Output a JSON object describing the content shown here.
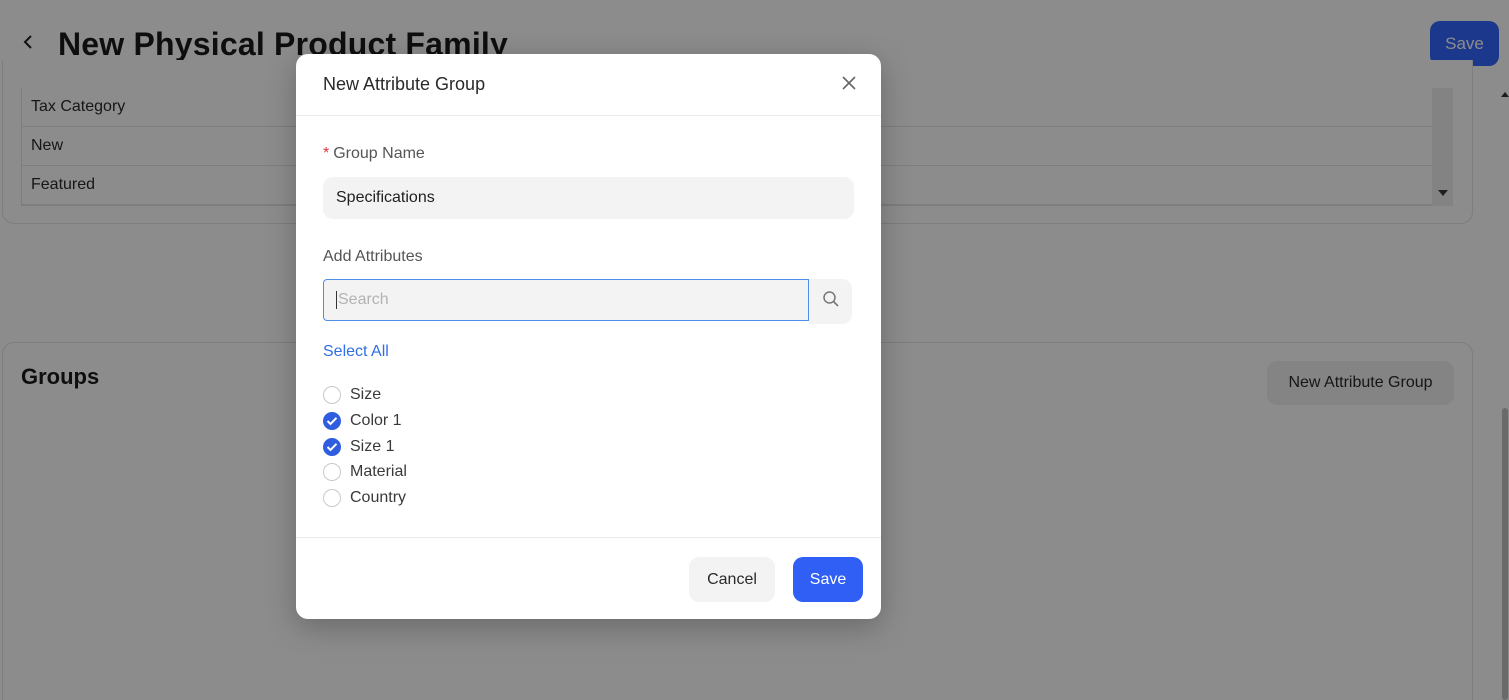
{
  "page": {
    "title": "New Physical Product Family",
    "save_label": "Save",
    "attribute_rows": [
      "Tax Category",
      "New",
      "Featured"
    ],
    "groups_title": "Groups",
    "new_group_button": "New Attribute Group"
  },
  "modal": {
    "title": "New Attribute Group",
    "group_name_label": "Group Name",
    "group_name_value": "Specifications",
    "add_attributes_label": "Add Attributes",
    "search_placeholder": "Search",
    "select_all_label": "Select All",
    "attributes": [
      {
        "label": "Size",
        "checked": false
      },
      {
        "label": "Color 1",
        "checked": true
      },
      {
        "label": "Size 1",
        "checked": true
      },
      {
        "label": "Material",
        "checked": false
      },
      {
        "label": "Country",
        "checked": false
      }
    ],
    "cancel_label": "Cancel",
    "save_label": "Save"
  },
  "icons": {
    "back": "chevron-left-icon",
    "close": "close-icon",
    "search": "search-icon",
    "check": "check-icon"
  },
  "colors": {
    "primary": "#2f5ff5",
    "link": "#2f6fe4",
    "required": "#d9363e",
    "focus_border": "#4d8fe8"
  }
}
